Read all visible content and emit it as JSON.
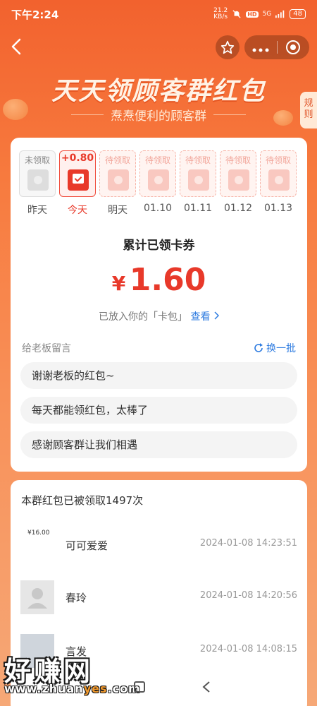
{
  "status_bar": {
    "time": "下午2:24",
    "net_speed_value": "21.2",
    "net_speed_unit": "KB/s",
    "hd_label": "HD",
    "network": "5G",
    "battery": "48"
  },
  "header": {
    "title": "天天领顾客群红包",
    "subtitle": "焘焘便利的顾客群",
    "rules_label": "规则"
  },
  "calendar": {
    "days": [
      {
        "status": "未领取",
        "label": "昨天",
        "state": "past"
      },
      {
        "status": "+0.80",
        "label": "今天",
        "state": "today"
      },
      {
        "status": "待领取",
        "label": "明天",
        "state": "pending"
      },
      {
        "status": "待领取",
        "label": "01.10",
        "state": "pending"
      },
      {
        "status": "待领取",
        "label": "01.11",
        "state": "pending"
      },
      {
        "status": "待领取",
        "label": "01.12",
        "state": "pending"
      },
      {
        "status": "待领取",
        "label": "01.13",
        "state": "pending"
      }
    ]
  },
  "summary": {
    "title": "累计已领卡券",
    "currency": "¥",
    "amount": "1.60",
    "pocket_text": "已放入你的「卡包」",
    "view_link": "查看"
  },
  "messages": {
    "heading": "给老板留言",
    "refresh_label": "换一批",
    "items": [
      "谢谢老板的红包~",
      "每天都能领红包，太棒了",
      "感谢顾客群让我们相遇"
    ]
  },
  "records": {
    "title": "本群红包已被领取1497次",
    "items": [
      {
        "avatar_text": "¥16.00",
        "name": "可可爱爱",
        "time": "2024-01-08 14:23:51"
      },
      {
        "avatar_text": "",
        "name": "春玲",
        "time": "2024-01-08 14:20:56"
      },
      {
        "avatar_text": "",
        "name": "言发",
        "time": "2024-01-08 14:08:15"
      }
    ]
  },
  "watermark": {
    "text": "好赚网",
    "url_prefix": "www.zhuan",
    "url_highlight": "yes",
    "url_suffix": ".com"
  },
  "colors": {
    "primary_red": "#e8392a",
    "link_blue": "#2d7be0",
    "header_orange": "#f2622e"
  }
}
